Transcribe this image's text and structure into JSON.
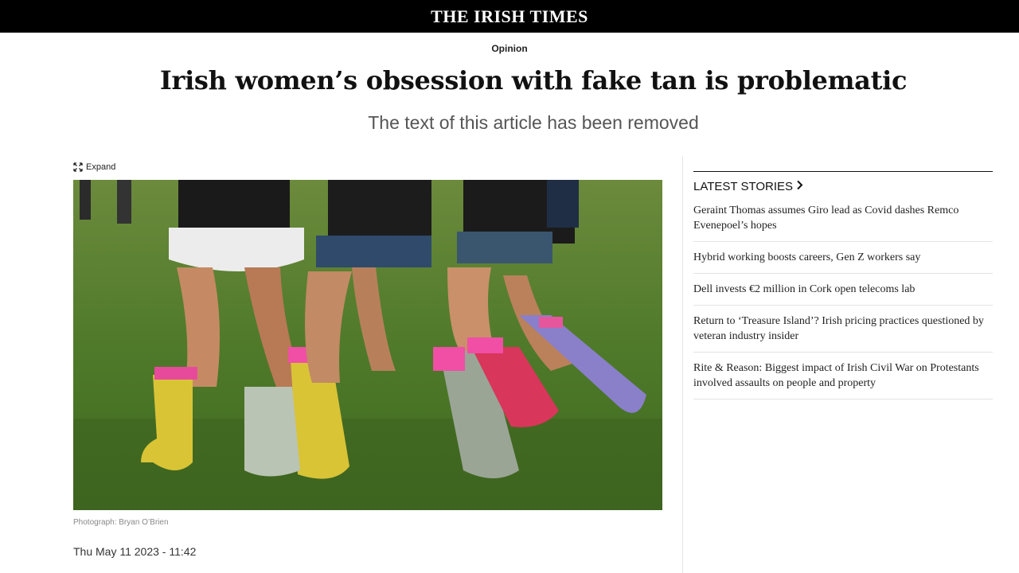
{
  "header": {
    "masthead": "THE IRISH TIMES"
  },
  "article": {
    "section": "Opinion",
    "headline": "Irish women’s obsession with fake tan is problematic",
    "subheadline": "The text of this article has been removed",
    "expand_label": "Expand",
    "photo_caption": "Photograph: Bryan O’Brien",
    "date": "Thu May 11 2023 - 11:42"
  },
  "sidebar": {
    "title": "LATEST STORIES",
    "items": [
      {
        "label": "Geraint Thomas assumes Giro lead as Covid dashes Remco Evenepoel’s hopes"
      },
      {
        "label": "Hybrid working boosts careers, Gen Z workers say"
      },
      {
        "label": "Dell invests €2 million in Cork open telecoms lab"
      },
      {
        "label": "Return to ‘Treasure Island’? Irish pricing practices questioned by veteran industry insider"
      },
      {
        "label": "Rite & Reason: Biggest impact of Irish Civil War on Protestants involved assaults on people and property"
      }
    ]
  }
}
